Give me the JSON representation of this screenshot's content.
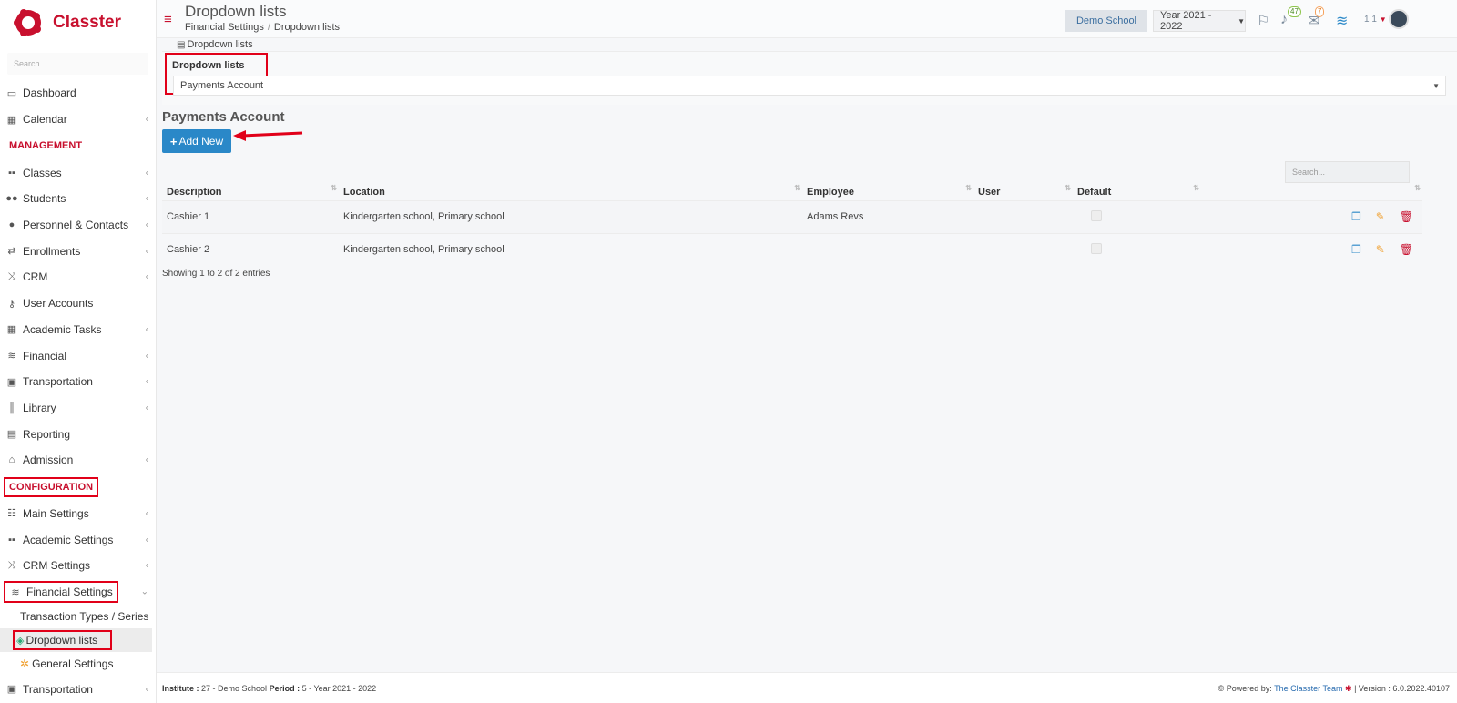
{
  "brand": {
    "name": "Classter"
  },
  "sidebar": {
    "search_placeholder": "Search...",
    "items_top": [
      {
        "label": "Dashboard",
        "icon": "laptop-icon",
        "chevron": false
      },
      {
        "label": "Calendar",
        "icon": "calendar-icon",
        "chevron": true
      }
    ],
    "management_title": "MANAGEMENT",
    "management_items": [
      {
        "label": "Classes",
        "icon": "classes-icon",
        "chevron": true
      },
      {
        "label": "Students",
        "icon": "students-icon",
        "chevron": true
      },
      {
        "label": "Personnel & Contacts",
        "icon": "person-icon",
        "chevron": true
      },
      {
        "label": "Enrollments",
        "icon": "exchange-icon",
        "chevron": true
      },
      {
        "label": "CRM",
        "icon": "shuffle-icon",
        "chevron": true
      },
      {
        "label": "User Accounts",
        "icon": "key-icon",
        "chevron": false
      },
      {
        "label": "Academic Tasks",
        "icon": "grid-icon",
        "chevron": true
      },
      {
        "label": "Financial",
        "icon": "coins-icon",
        "chevron": true
      },
      {
        "label": "Transportation",
        "icon": "bus-icon",
        "chevron": true
      },
      {
        "label": "Library",
        "icon": "books-icon",
        "chevron": true
      },
      {
        "label": "Reporting",
        "icon": "printer-icon",
        "chevron": false
      },
      {
        "label": "Admission",
        "icon": "bank-icon",
        "chevron": true
      }
    ],
    "configuration_title": "CONFIGURATION",
    "configuration_items": [
      {
        "label": "Main Settings",
        "icon": "sliders-icon",
        "chevron": true
      },
      {
        "label": "Academic Settings",
        "icon": "classes-icon",
        "chevron": true
      },
      {
        "label": "CRM Settings",
        "icon": "shuffle-icon",
        "chevron": true
      }
    ],
    "financial_settings": "Financial Settings",
    "sub_items": [
      "Transaction Types / Series",
      "Dropdown lists",
      "General Settings"
    ],
    "transportation_bottom": "Transportation"
  },
  "header": {
    "title": "Dropdown lists",
    "breadcrumb": [
      "Financial Settings",
      "Dropdown lists"
    ],
    "school": "Demo School",
    "year": "Year 2021 - 2022",
    "notifications_count": "47",
    "messages_count": "7",
    "user_number": "1 1"
  },
  "main": {
    "panel_title": "Dropdown lists",
    "dropdown_label": "Dropdown lists",
    "dropdown_value": "Payments Account",
    "section_title": "Payments Account",
    "add_new": "Add New",
    "search_placeholder": "Search...",
    "columns": [
      "Description",
      "Location",
      "Employee",
      "User",
      "Default"
    ],
    "rows": [
      {
        "description": "Cashier 1",
        "location": "Kindergarten school, Primary school",
        "employee": "Adams Revs",
        "user": ""
      },
      {
        "description": "Cashier 2",
        "location": "Kindergarten school, Primary school",
        "employee": "",
        "user": ""
      }
    ],
    "showing": "Showing 1 to 2 of 2 entries"
  },
  "footer": {
    "institute_label": "Institute :",
    "institute_value": "27 - Demo School",
    "period_label": "Period :",
    "period_value": "5 - Year 2021 - 2022",
    "powered_by": "Powered by:",
    "team": "The Classter Team",
    "version": "| Version : 6.0.2022.40107"
  },
  "colors": {
    "accent": "#c8102e",
    "primary_button": "#2a88c8",
    "highlight_box": "#e10019"
  }
}
